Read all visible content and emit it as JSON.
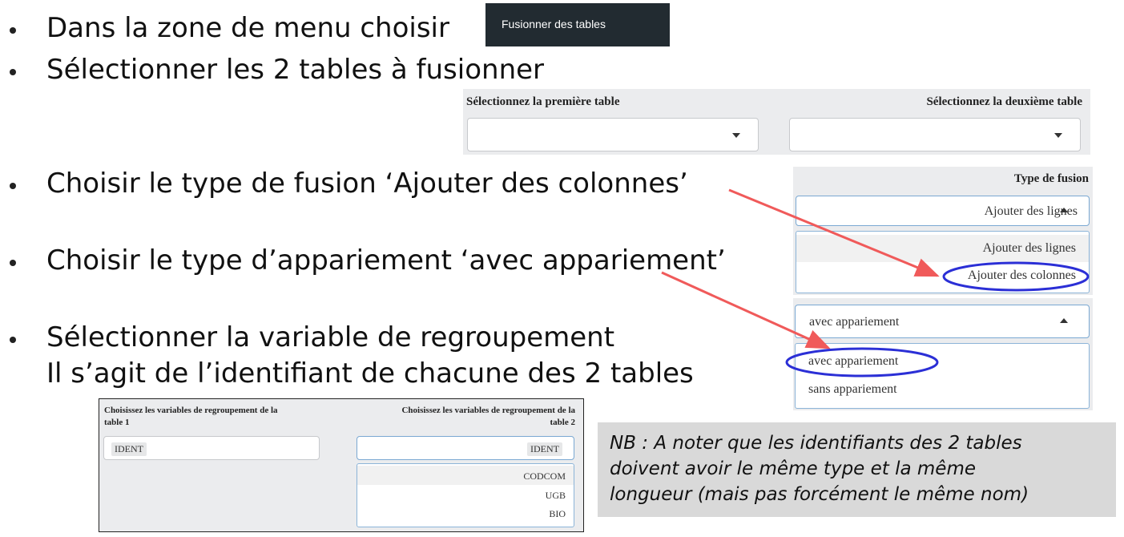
{
  "bullets": [
    "Dans la zone de menu choisir",
    "Sélectionner les 2 tables à fusionner",
    "Choisir le type de fusion ‘Ajouter des colonnes’",
    "Choisir le type d’appariement  ‘avec appariement’",
    "Sélectionner la variable de regroupement",
    "Il s’agit de l’identifiant de chacune des 2 tables"
  ],
  "menu_button": "Fusionner des tables",
  "tables_panel": {
    "first_label": "Sélectionnez la première table",
    "second_label": "Sélectionnez la deuxième table",
    "first_value": "",
    "second_value": ""
  },
  "fusion_panel": {
    "label": "Type de fusion",
    "selected": "Ajouter des lignes",
    "options": [
      "Ajouter des lignes",
      "Ajouter des colonnes"
    ]
  },
  "appariement_panel": {
    "selected": "avec appariement",
    "options": [
      "avec appariement",
      "sans appariement"
    ]
  },
  "regroup_panel": {
    "label1_line1": "Choisissez les variables de regroupement de la",
    "label1_line2": "table 1",
    "label2_line1": "Choisissez les variables de regroupement de la",
    "label2_line2": "table 2",
    "value1": "IDENT",
    "value2": "IDENT",
    "options": [
      "CODCOM",
      "UGB",
      "BIO"
    ]
  },
  "note": {
    "line1": "NB : A noter que les identifiants des 2 tables",
    "line2": "doivent avoir le même type et la même",
    "line3": "longueur (mais pas forcément le même nom)"
  },
  "colors": {
    "arrow": "#f05a5a",
    "highlight_ellipse": "#2b2fd6",
    "menu_bg": "#222b31",
    "note_bg": "#d9d9d9"
  }
}
